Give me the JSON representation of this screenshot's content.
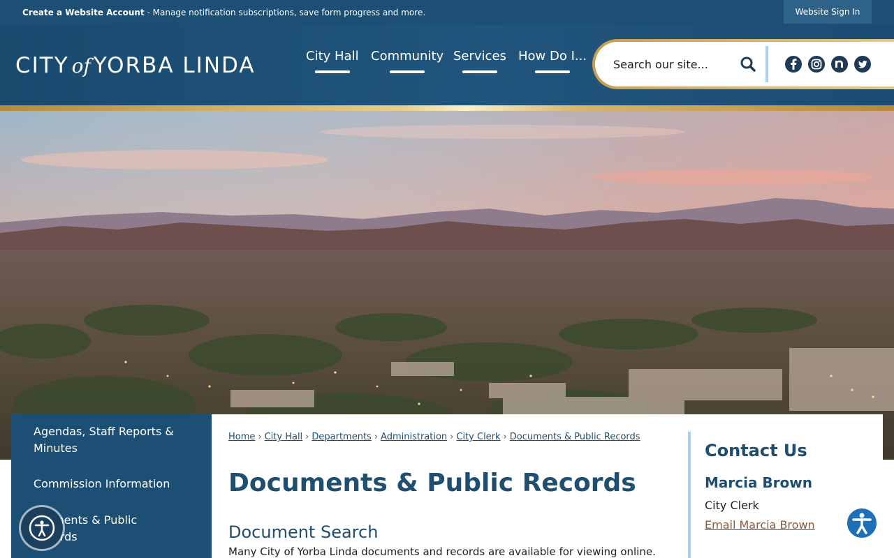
{
  "topbar": {
    "notice_bold": "Create a Website Account",
    "notice_text": " - Manage notification subscriptions, save form progress and more.",
    "signin_label": "Website Sign In"
  },
  "header": {
    "logo_city": "CITY",
    "logo_of": "of",
    "logo_name": "YORBA LINDA",
    "nav": [
      "City Hall",
      "Community",
      "Services",
      "How Do I..."
    ],
    "search_placeholder": "Search our site...",
    "social_icons": [
      "facebook-icon",
      "instagram-icon",
      "nextdoor-icon",
      "twitter-icon"
    ]
  },
  "sidebar": {
    "items": [
      "Agendas, Staff Reports & Minutes",
      "Commission Information",
      "ments & Public",
      "ords"
    ]
  },
  "breadcrumb": [
    "Home",
    "City Hall",
    "Departments",
    "Administration",
    "City Clerk",
    "Documents & Public Records"
  ],
  "main": {
    "title": "Documents & Public Records",
    "section_title": "Document Search",
    "section_text": "Many City of Yorba Linda documents and records are available for viewing online."
  },
  "contact": {
    "heading": "Contact Us",
    "name": "Marcia Brown",
    "role": "City Clerk",
    "email_label": "Email Marcia Brown"
  },
  "colors": {
    "brand_blue": "#1d4e73",
    "gold": "#d7b46a",
    "light_blue": "#a9d2ee"
  }
}
